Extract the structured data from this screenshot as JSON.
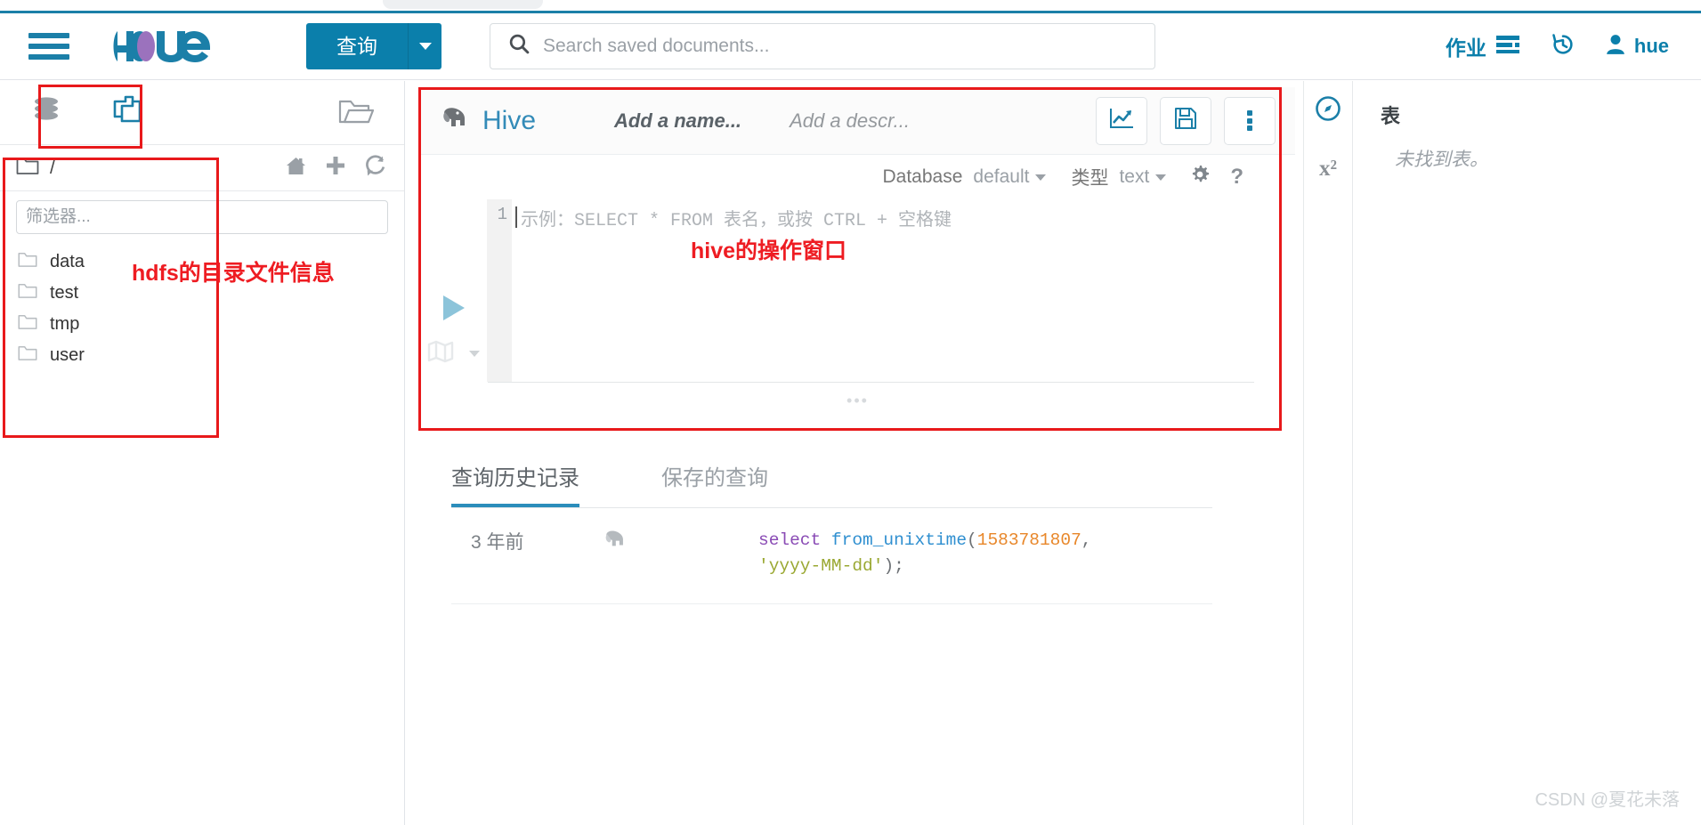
{
  "header": {
    "menu_icon": "hamburger-icon",
    "logo_text": "hue",
    "query_button_label": "查询",
    "query_caret_icon": "chevron-down-icon",
    "search": {
      "icon": "search-icon",
      "placeholder": "Search saved documents...",
      "value": ""
    },
    "right": {
      "jobs_label": "作业",
      "jobs_icon": "job-list-icon",
      "history_icon": "history-clock-icon",
      "user_icon": "user-icon",
      "user_name": "hue"
    }
  },
  "sidebar": {
    "tabs": [
      {
        "name": "database-assist",
        "icon": "database-stack-icon",
        "active": false
      },
      {
        "name": "files-assist",
        "icon": "documents-copy-icon",
        "active": true
      }
    ],
    "open_folder_icon": "open-folder-icon",
    "breadcrumb": {
      "folder_icon": "folder-icon",
      "path": "/",
      "actions": [
        {
          "name": "home-button",
          "icon": "home-icon"
        },
        {
          "name": "new-button",
          "icon": "plus-icon"
        },
        {
          "name": "refresh-button",
          "icon": "refresh-icon"
        }
      ]
    },
    "filter": {
      "placeholder": "筛选器...",
      "value": ""
    },
    "files": [
      {
        "icon": "folder-icon",
        "name": "data"
      },
      {
        "icon": "folder-icon",
        "name": "test"
      },
      {
        "icon": "folder-icon",
        "name": "tmp"
      },
      {
        "icon": "folder-icon",
        "name": "user"
      }
    ]
  },
  "editor": {
    "engine_icon": "hive-elephant-icon",
    "engine_name": "Hive",
    "name_placeholder": "Add a name...",
    "description_placeholder": "Add a descr...",
    "actions": [
      {
        "name": "chart-button",
        "icon": "chart-line-icon"
      },
      {
        "name": "save-button",
        "icon": "floppy-save-icon"
      },
      {
        "name": "more-options-button",
        "icon": "kebab-menu-icon"
      }
    ],
    "toolbar": {
      "database_label": "Database",
      "database_value": "default",
      "type_label": "类型",
      "type_value": "text",
      "settings_icon": "gear-icon",
      "help_icon": "question-mark-icon"
    },
    "run_icon": "play-triangle-icon",
    "explain_icon": "map-book-icon",
    "explain_caret_icon": "chevron-down-icon",
    "line_number": "1",
    "placeholder": "示例：SELECT * FROM 表名，或按 CTRL + 空格键",
    "drag_handle": "•••"
  },
  "results": {
    "tabs": [
      {
        "label": "查询历史记录",
        "active": true
      },
      {
        "label": "保存的查询",
        "active": false
      }
    ],
    "history": [
      {
        "time": "3 年前",
        "icon": "hive-elephant-icon",
        "sql_parts": [
          {
            "t": "select ",
            "c": "kw"
          },
          {
            "t": "from_unixtime",
            "c": "fn"
          },
          {
            "t": "(",
            "c": "pun"
          },
          {
            "t": "1583781807",
            "c": "num"
          },
          {
            "t": ", ",
            "c": "pun"
          },
          {
            "t": "'yyyy-MM-dd'",
            "c": "str"
          },
          {
            "t": ");",
            "c": "pun"
          }
        ]
      }
    ]
  },
  "right_panel": {
    "rail": [
      {
        "name": "assistant-tab",
        "icon": "compass-icon",
        "active": true
      },
      {
        "name": "functions-tab",
        "icon": "x-squared-icon",
        "active": false
      }
    ],
    "title": "表",
    "empty_message": "未找到表。"
  },
  "annotations": {
    "hdfs_note": "hdfs的目录文件信息",
    "hive_note": "hive的操作窗口",
    "color": "#ee1c22"
  },
  "watermark": "CSDN @夏花未落"
}
